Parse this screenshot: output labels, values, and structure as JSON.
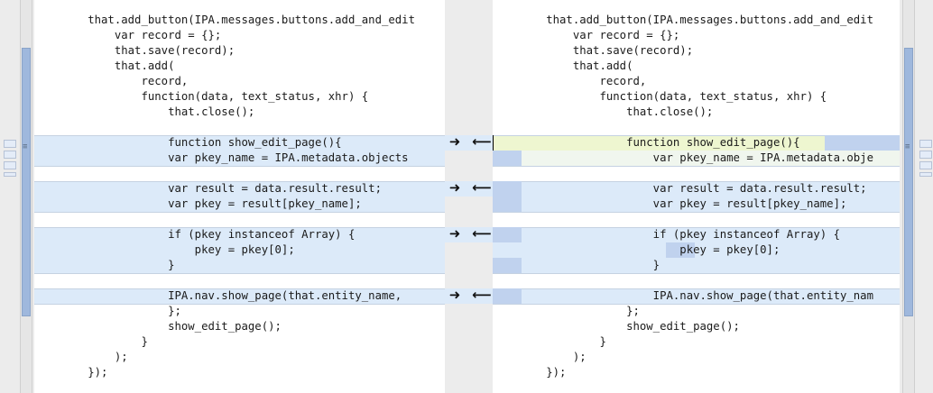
{
  "left_pane": {
    "lines": [
      "        that.add_button(IPA.messages.buttons.add_and_edit",
      "            var record = {};",
      "            that.save(record);",
      "            that.add(",
      "                record,",
      "                function(data, text_status, xhr) {",
      "                    that.close();",
      "",
      "                    function show_edit_page(){",
      "                    var pkey_name = IPA.metadata.objects",
      "",
      "                    var result = data.result.result;",
      "                    var pkey = result[pkey_name];",
      "",
      "                    if (pkey instanceof Array) {",
      "                        pkey = pkey[0];",
      "                    }",
      "",
      "                    IPA.nav.show_page(that.entity_name,",
      "                    };",
      "                    show_edit_page();",
      "                }",
      "            );",
      "        });"
    ]
  },
  "right_pane": {
    "lines": [
      "        that.add_button(IPA.messages.buttons.add_and_edit",
      "            var record = {};",
      "            that.save(record);",
      "            that.add(",
      "                record,",
      "                function(data, text_status, xhr) {",
      "                    that.close();",
      "",
      "                    function show_edit_page(){",
      "                        var pkey_name = IPA.metadata.obje",
      "",
      "                        var result = data.result.result;",
      "                        var pkey = result[pkey_name];",
      "",
      "                        if (pkey instanceof Array) {",
      "                            pkey = pkey[0];",
      "                        }",
      "",
      "                        IPA.nav.show_page(that.entity_nam",
      "                    };",
      "                    show_edit_page();",
      "                }",
      "            );",
      "        });"
    ]
  },
  "gutter": {
    "push_right_glyph": "➜",
    "push_left_glyph": "⟵"
  },
  "colors": {
    "changed": "#dceaf9",
    "selected_line": "#eef6d0",
    "inline_change": "#c0d2ee"
  }
}
